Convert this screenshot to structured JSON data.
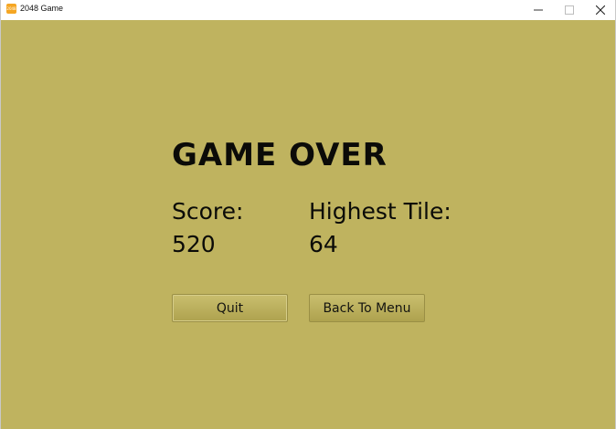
{
  "window": {
    "title": "2048 Game",
    "icon_text": "2048",
    "icon_name": "app-2048-icon",
    "controls": {
      "minimize_icon": "minimize-icon",
      "maximize_icon": "maximize-icon",
      "close_icon": "close-icon"
    }
  },
  "game_over": {
    "title": "GAME OVER",
    "score_label": "Score:",
    "score_value": "520",
    "highest_tile_label": "Highest Tile:",
    "highest_tile_value": "64",
    "quit_label": "Quit",
    "back_to_menu_label": "Back To Menu"
  },
  "colors": {
    "background": "#bfb35f",
    "text": "#0b0b08",
    "button": "#b8ad58",
    "app_icon": "#f5a623"
  }
}
